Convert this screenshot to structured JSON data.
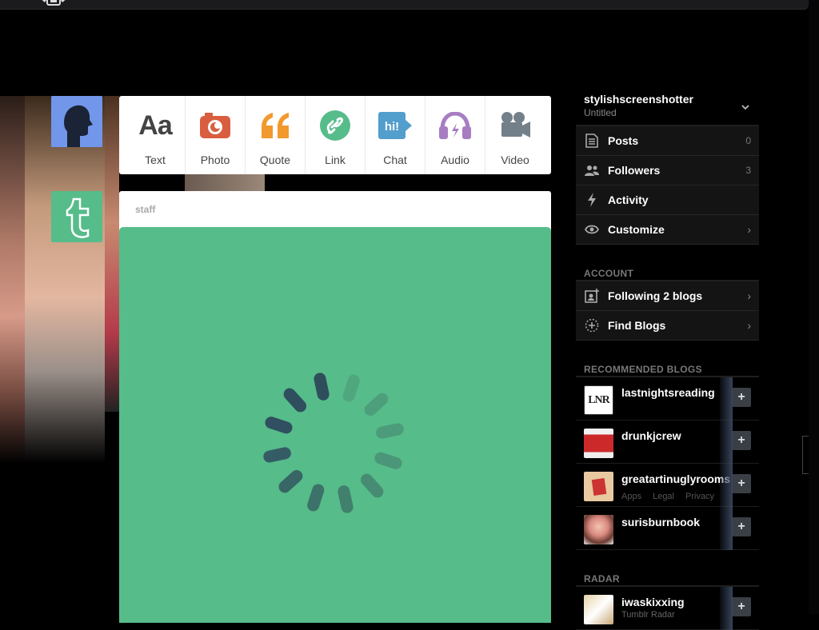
{
  "post_types": [
    {
      "label": "Text",
      "icon": "text-icon",
      "color": "#444444"
    },
    {
      "label": "Photo",
      "icon": "camera-icon",
      "color": "#d95e40"
    },
    {
      "label": "Quote",
      "icon": "quote-icon",
      "color": "#f2992e"
    },
    {
      "label": "Link",
      "icon": "link-icon",
      "color": "#56bc8a"
    },
    {
      "label": "Chat",
      "icon": "chat-icon",
      "color": "#529ecc"
    },
    {
      "label": "Audio",
      "icon": "headphones-icon",
      "color": "#a77dc2"
    },
    {
      "label": "Video",
      "icon": "video-camera-icon",
      "color": "#748089"
    }
  ],
  "post": {
    "author": "staff",
    "media_color": "#56bc8a"
  },
  "sidebar": {
    "blog_name": "stylishscreenshotter",
    "blog_sub": "Untitled",
    "items": [
      {
        "label": "Posts",
        "count": "0",
        "icon": "posts-icon"
      },
      {
        "label": "Followers",
        "count": "3",
        "icon": "followers-icon"
      },
      {
        "label": "Activity",
        "count": "",
        "icon": "lightning-icon"
      },
      {
        "label": "Customize",
        "count": "",
        "icon": "eye-icon"
      }
    ],
    "account_title": "ACCOUNT",
    "account_items": [
      {
        "label": "Following 2 blogs",
        "icon": "following-icon"
      },
      {
        "label": "Find Blogs",
        "icon": "find-blogs-icon"
      }
    ],
    "recommended_title": "RECOMMENDED BLOGS",
    "recommended": [
      {
        "name": "lastnightsreading",
        "thumb_text": "LNR"
      },
      {
        "name": "drunkjcrew",
        "thumb_text": ""
      },
      {
        "name": "greatartinuglyrooms",
        "thumb_text": ""
      },
      {
        "name": "surisburnbook",
        "thumb_text": ""
      }
    ],
    "footer_links": [
      "Apps",
      "Legal",
      "Privacy"
    ],
    "radar_title": "RADAR",
    "radar": {
      "name": "iwaskixxing",
      "sub": "Tumblr Radar"
    },
    "follow_symbol": "+"
  }
}
